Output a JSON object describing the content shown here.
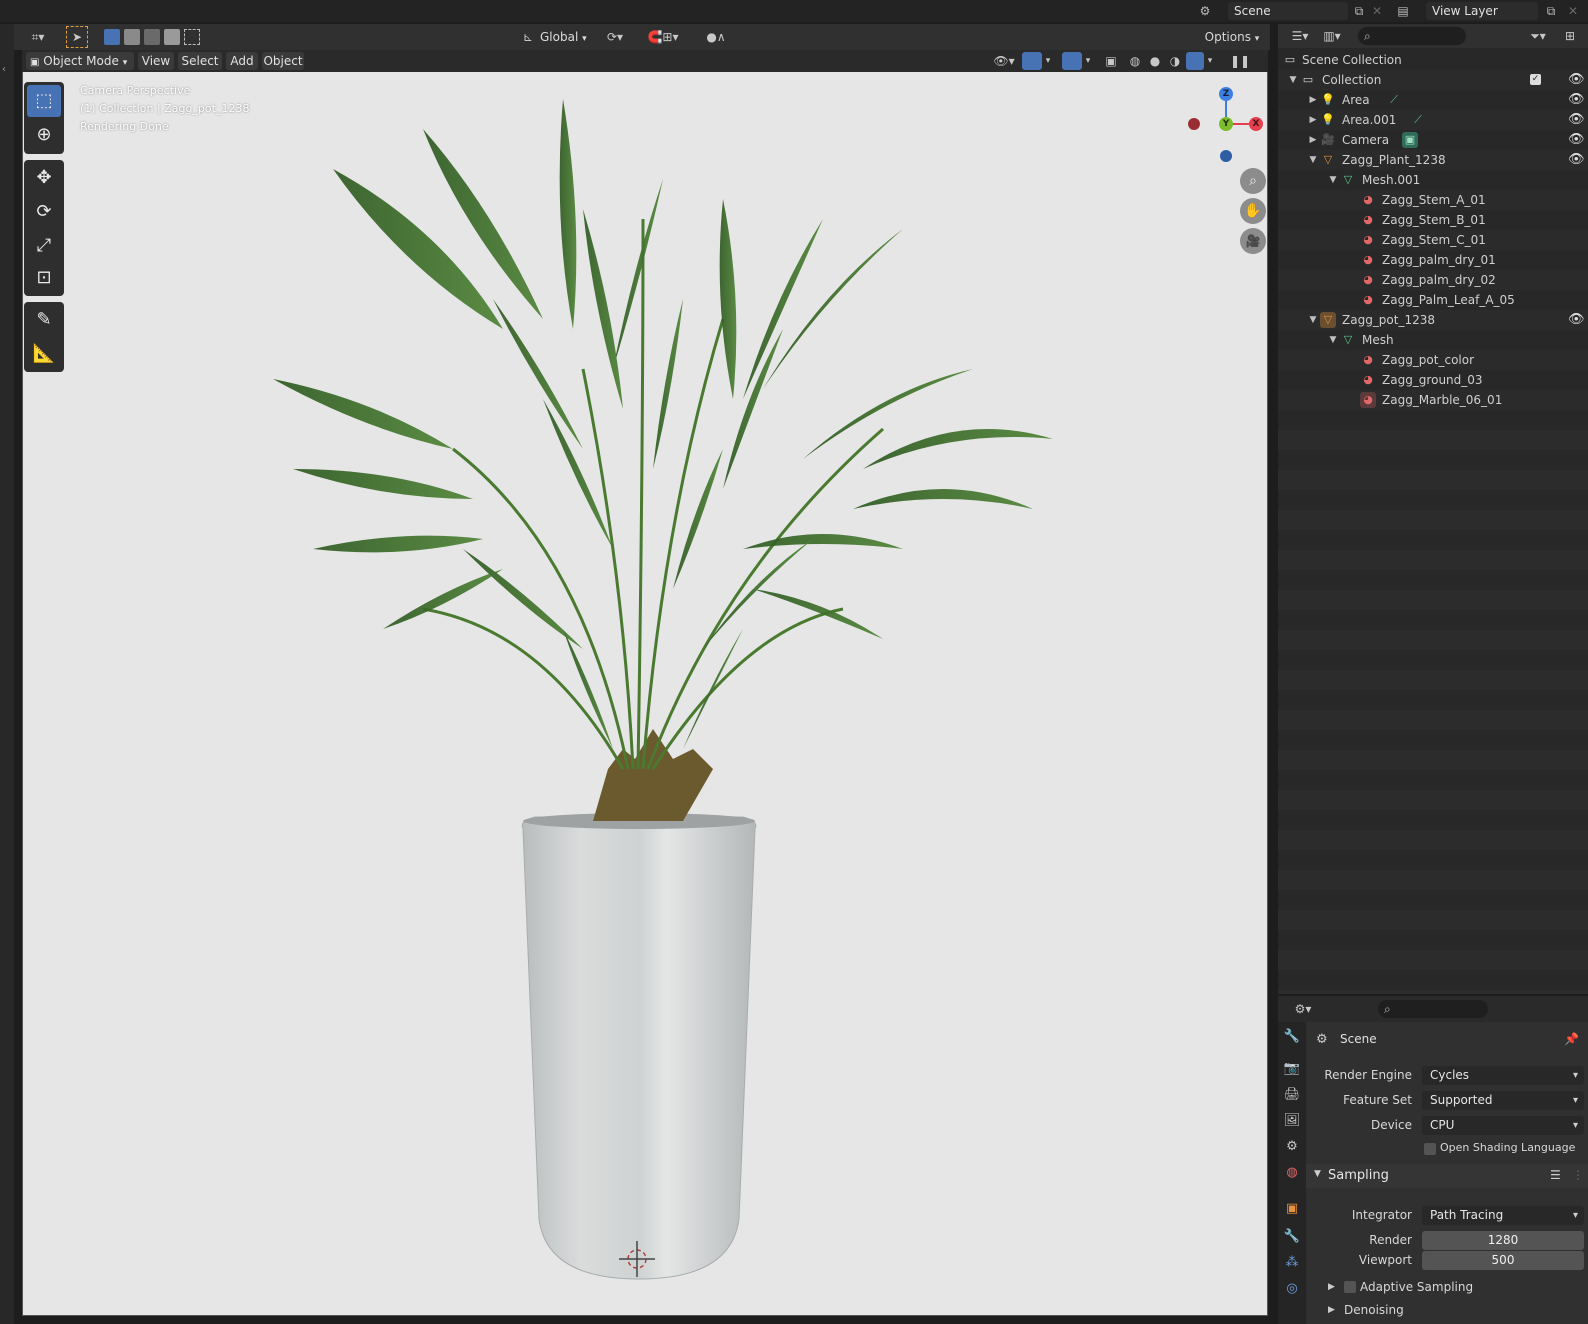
{
  "topbar": {
    "scene_label": "Scene",
    "view_layer_label": "View Layer"
  },
  "viewport_header": {
    "transform_orientation": "Global",
    "options_label": "Options"
  },
  "viewport_menu": {
    "mode": "Object Mode",
    "view": "View",
    "select": "Select",
    "add": "Add",
    "object": "Object"
  },
  "viewport_overlay": {
    "line1": "Camera Perspective",
    "line2": "(1) Collection | Zagg_pot_1238",
    "line3": "Rendering Done"
  },
  "navigation_gizmo": {
    "z": "Z",
    "y": "Y",
    "x": "X"
  },
  "outliner": {
    "root": "Scene Collection",
    "items": [
      {
        "label": "Collection"
      },
      {
        "label": "Area"
      },
      {
        "label": "Area.001"
      },
      {
        "label": "Camera"
      },
      {
        "label": "Zagg_Plant_1238"
      },
      {
        "label": "Mesh.001"
      },
      {
        "label": "Zagg_Stem_A_01"
      },
      {
        "label": "Zagg_Stem_B_01"
      },
      {
        "label": "Zagg_Stem_C_01"
      },
      {
        "label": "Zagg_palm_dry_01"
      },
      {
        "label": "Zagg_palm_dry_02"
      },
      {
        "label": "Zagg_Palm_Leaf_A_05"
      },
      {
        "label": "Zagg_pot_1238"
      },
      {
        "label": "Mesh"
      },
      {
        "label": "Zagg_pot_color"
      },
      {
        "label": "Zagg_ground_03"
      },
      {
        "label": "Zagg_Marble_06_01"
      }
    ]
  },
  "properties": {
    "context_title": "Scene",
    "render_engine_label": "Render Engine",
    "render_engine_value": "Cycles",
    "feature_set_label": "Feature Set",
    "feature_set_value": "Supported",
    "device_label": "Device",
    "device_value": "CPU",
    "osl_label": "Open Shading Language",
    "sampling_label": "Sampling",
    "integrator_label": "Integrator",
    "integrator_value": "Path Tracing",
    "render_label": "Render",
    "render_value": "1280",
    "viewport_label": "Viewport",
    "viewport_value": "500",
    "adaptive_label": "Adaptive Sampling",
    "denoising_label": "Denoising"
  },
  "colors": {
    "accent": "#4772b3",
    "axis_x": "#e5404f",
    "axis_y": "#7cbc2c",
    "axis_z": "#3c7fe0",
    "viewport_bg": "#e6e6e6"
  }
}
